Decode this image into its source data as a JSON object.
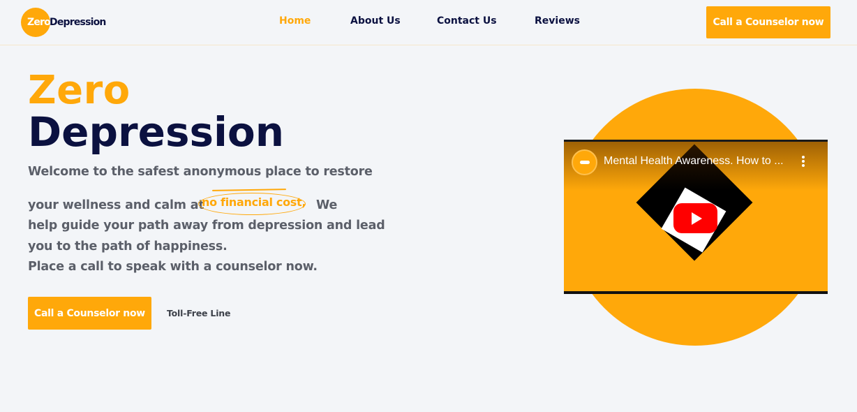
{
  "brand": {
    "logo_zero": "Zero",
    "logo_depression": "Depression"
  },
  "nav": {
    "items": [
      {
        "label": "Home",
        "active": true
      },
      {
        "label": "About Us",
        "active": false
      },
      {
        "label": "Contact Us",
        "active": false
      },
      {
        "label": "Reviews",
        "active": false
      }
    ],
    "cta_label": "Call a Counselor now"
  },
  "hero": {
    "title_line1": "Zero",
    "title_line2": "Depression",
    "text_line1": "Welcome to the safest anonymous place to restore",
    "text_line2_before": "your wellness and calm at",
    "highlight": "no financial cost,",
    "text_line2_after": "We",
    "text_line3": "help guide your path away from depression and lead",
    "text_line4": "you to the path of happiness.",
    "text_line5": "Place a call to speak with a counselor now.",
    "cta_label": "Call a Counselor now",
    "tollfree_label": "Toll-Free Line"
  },
  "video": {
    "title": "Mental Health Awareness. How to ...",
    "play_icon": "youtube-play-icon",
    "menu_icon": "kebab-menu-icon"
  },
  "colors": {
    "accent": "#ffa80a",
    "navy": "#0b1140",
    "body_text": "#5b5f69",
    "background": "#f3f5f8"
  }
}
